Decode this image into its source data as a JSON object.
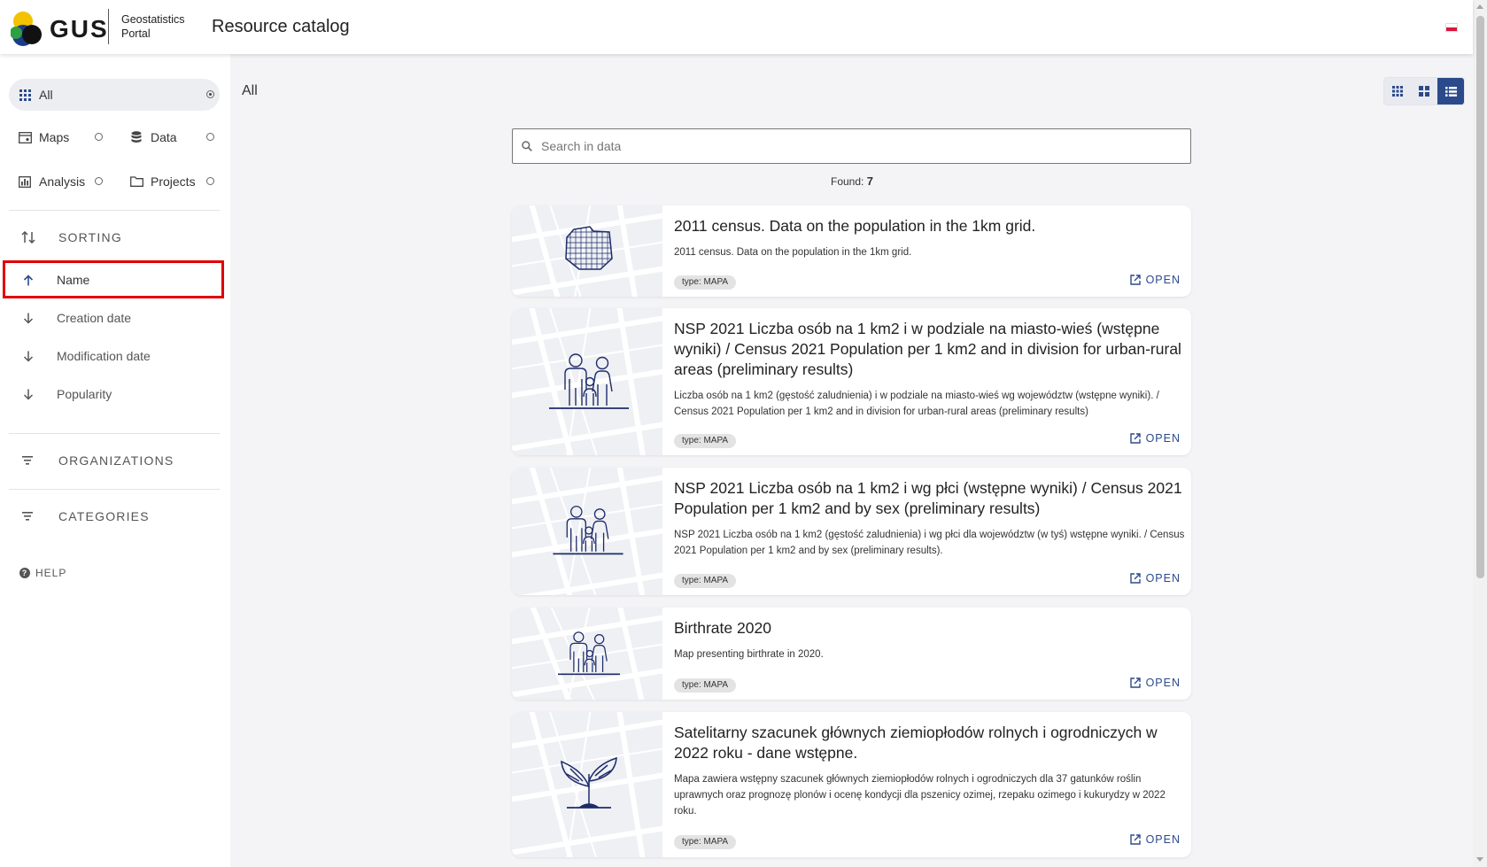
{
  "header": {
    "logo_text": "GUS",
    "brand_line1": "Geostatistics",
    "brand_line2": "Portal",
    "app_title": "Resource catalog",
    "language_flag": "pl-flag-icon"
  },
  "sidebar": {
    "types": [
      {
        "label": "All",
        "icon": "grid-icon",
        "selected": true
      },
      {
        "label": "Maps",
        "icon": "map-icon",
        "selected": false
      },
      {
        "label": "Data",
        "icon": "database-icon",
        "selected": false
      },
      {
        "label": "Analysis",
        "icon": "chart-icon",
        "selected": false
      },
      {
        "label": "Projects",
        "icon": "folder-icon",
        "selected": false
      }
    ],
    "sorting_title": "SORTING",
    "sort_options": [
      {
        "label": "Name",
        "direction": "up",
        "active": true
      },
      {
        "label": "Creation date",
        "direction": "down",
        "active": false
      },
      {
        "label": "Modification date",
        "direction": "down",
        "active": false
      },
      {
        "label": "Popularity",
        "direction": "down",
        "active": false
      }
    ],
    "organizations_title": "ORGANIZATIONS",
    "categories_title": "CATEGORIES",
    "help_label": "HELP"
  },
  "main": {
    "breadcrumb": "All",
    "view_modes": [
      "small-grid",
      "large-grid",
      "list"
    ],
    "active_view": "list",
    "search_placeholder": "Search in data",
    "found_label": "Found:",
    "found_count": "7",
    "open_label": "OPEN",
    "results": [
      {
        "title": "2011 census. Data on the population in the 1km grid.",
        "description": "2011 census. Data on the population in the 1km grid.",
        "type": "type: MAPA",
        "thumbnail": "grid-map-icon"
      },
      {
        "title": "NSP 2021 Liczba osób na 1 km2 i w podziale na miasto-wieś (wstępne wyniki) / Census 2021 Population per 1 km2 and in division for urban-rural areas (preliminary results)",
        "description": "Liczba osób na 1 km2 (gęstość zaludnienia) i w podziale na miasto-wieś wg województw (wstępne wyniki). / Census 2021 Population per 1 km2 and in division for urban-rural areas (preliminary results)",
        "type": "type: MAPA",
        "thumbnail": "family-icon"
      },
      {
        "title": "NSP 2021 Liczba osób na 1 km2 i wg płci (wstępne wyniki) / Census 2021 Population per 1 km2 and by sex (preliminary results)",
        "description": "NSP 2021 Liczba osób na 1 km2 (gęstość zaludnienia) i wg płci dla województw (w tyś) wstępne wyniki. / Census 2021 Population per 1 km2 and by sex (preliminary results).",
        "type": "type: MAPA",
        "thumbnail": "family-icon"
      },
      {
        "title": "Birthrate 2020",
        "description": "Map presenting birthrate in 2020.",
        "type": "type: MAPA",
        "thumbnail": "family-icon"
      },
      {
        "title": "Satelitarny szacunek głównych ziemiopłodów rolnych i ogrodniczych w 2022 roku - dane wstępne.",
        "description": "Mapa zawiera wstępny szacunek głównych ziemiopłodów rolnych i ogrodniczych dla 37 gatunków roślin uprawnych oraz prognozę plonów i ocenę kondycji dla pszenicy ozimej, rzepaku ozimego i kukurydzy w 2022 roku.",
        "type": "type: MAPA",
        "thumbnail": "plant-icon"
      }
    ]
  },
  "colors": {
    "accent": "#2b4a8b",
    "highlight": "#e00000",
    "background": "#f4f4f6"
  }
}
